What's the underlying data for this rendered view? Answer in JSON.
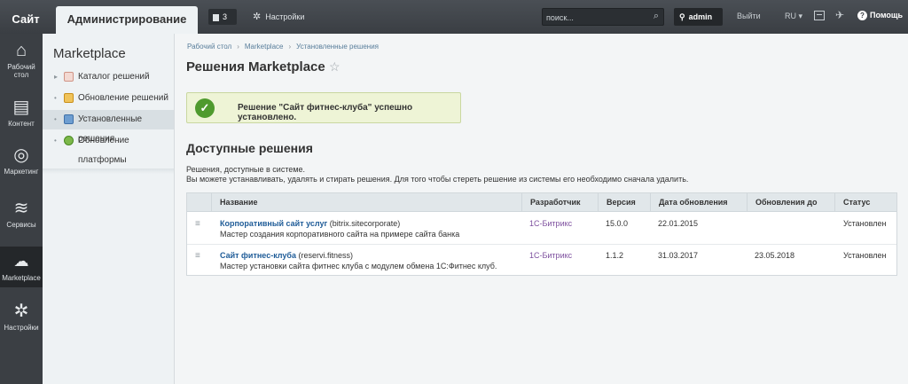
{
  "topbar": {
    "site_tab": "Сайт",
    "admin_tab": "Администрирование",
    "notifications_count": "3",
    "settings_label": "Настройки",
    "search_placeholder": "поиск...",
    "user": "admin",
    "logout": "Выйти",
    "lang": "RU",
    "help": "Помощь"
  },
  "rail": [
    {
      "label_l1": "Рабочий",
      "label_l2": "стол",
      "icon": "home-icon"
    },
    {
      "label_l1": "Контент",
      "label_l2": "",
      "icon": "document-icon"
    },
    {
      "label_l1": "Маркетинг",
      "label_l2": "",
      "icon": "target-icon"
    },
    {
      "label_l1": "Сервисы",
      "label_l2": "",
      "icon": "layers-icon"
    },
    {
      "label_l1": "Marketplace",
      "label_l2": "",
      "icon": "cloud-icon"
    },
    {
      "label_l1": "Настройки",
      "label_l2": "",
      "icon": "gear-icon"
    }
  ],
  "submenu": {
    "title": "Marketplace",
    "items": [
      {
        "label": "Каталог решений"
      },
      {
        "label": "Обновление решений"
      },
      {
        "label": "Установленные решения"
      },
      {
        "label": "Обновление платформы"
      }
    ]
  },
  "breadcrumbs": [
    "Рабочий стол",
    "Marketplace",
    "Установленные решения"
  ],
  "page_title": "Решения Marketplace",
  "success_message": "Решение \"Сайт фитнес-клуба\" успешно установлено.",
  "section_title": "Доступные решения",
  "description_line1": "Решения, доступные в системе.",
  "description_line2": "Вы можете устанавливать, удалять и стирать решения. Для того чтобы стереть решение из системы его необходимо сначала удалить.",
  "table": {
    "headers": [
      "Название",
      "Разработчик",
      "Версия",
      "Дата обновления",
      "Обновления до",
      "Статус"
    ],
    "rows": [
      {
        "name": "Корпоративный сайт услуг",
        "code": "(bitrix.sitecorporate)",
        "description": "Мастер создания корпоративного сайта на примере сайта банка",
        "developer": "1С-Битрикс",
        "version": "15.0.0",
        "updated": "22.01.2015",
        "updates_until": "",
        "status": "Установлен"
      },
      {
        "name": "Сайт фитнес-клуба",
        "code": "(reservi.fitness)",
        "description": "Мастер установки сайта фитнес клуба с модулем обмена 1С:Фитнес клуб.",
        "developer": "1С-Битрикс",
        "version": "1.1.2",
        "updated": "31.03.2017",
        "updates_until": "23.05.2018",
        "status": "Установлен"
      }
    ]
  }
}
